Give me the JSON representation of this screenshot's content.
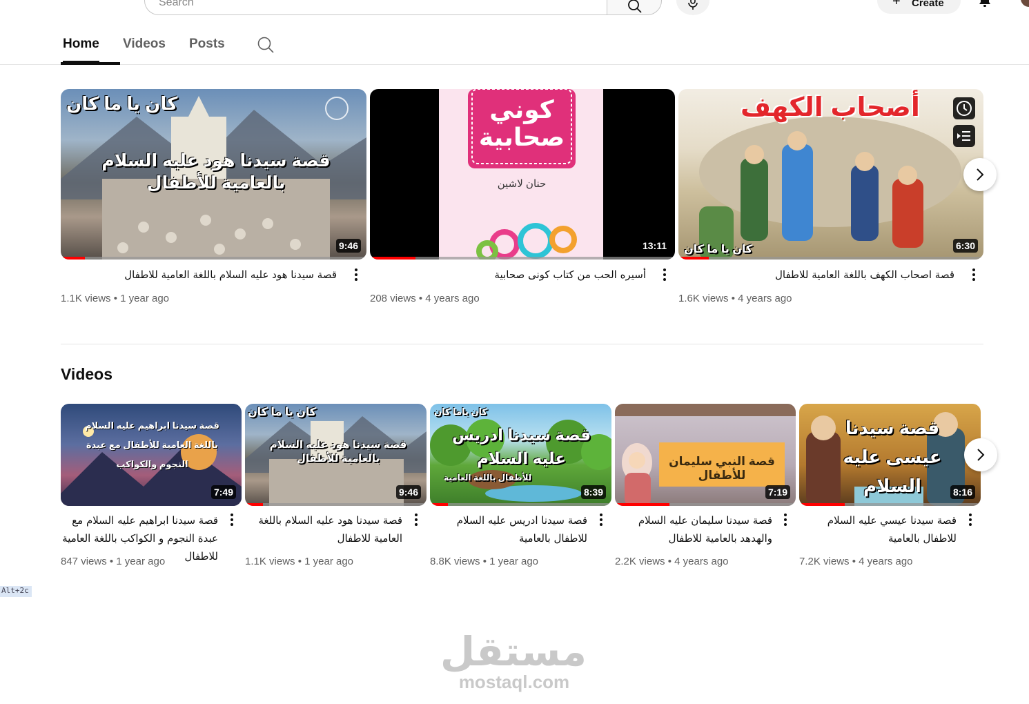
{
  "header": {
    "search_placeholder": "Search",
    "create_label": "Create"
  },
  "tabs": [
    {
      "label": "Home"
    },
    {
      "label": "Videos"
    },
    {
      "label": "Posts"
    }
  ],
  "featured": [
    {
      "title": "قصة سيدنا هود عليه السلام باللغة العامية للاطفال",
      "views": "1.1K views",
      "age": "1 year ago",
      "duration": "9:46",
      "progress": 0.08,
      "thumb_top_text": "كان يا ما كان",
      "thumb_main_text": "قصة سيدنا هود عليه السلام بالعامية للأطفال"
    },
    {
      "title": "أسيره الحب من كتاب كونى صحابية",
      "views": "208 views",
      "age": "4 years ago",
      "duration": "13:11",
      "progress": 0.15,
      "thumb_main_text": "كوني صحابية",
      "thumb_sub_text": "حنان لاشين"
    },
    {
      "title": "قصة اصحاب الكهف باللغة العامية للاطفال",
      "views": "1.6K views",
      "age": "4 years ago",
      "duration": "6:30",
      "progress": 0.1,
      "thumb_top_text": "أصحاب الكهف",
      "thumb_bottom_text": "كان يا ما كان"
    }
  ],
  "videos_section": {
    "title": "Videos",
    "items": [
      {
        "title": "قصة سيدنا ابراهيم عليه السلام مع عبدة النجوم و الكواكب باللغة العامية للاطفال",
        "views": "847 views",
        "age": "1 year ago",
        "duration": "7:49",
        "progress": 0.0,
        "thumb_main_text": "قصة سيدنا ابراهيم عليه السلام باللغة العامية للأطفال مع عبدة النجوم والكواكب"
      },
      {
        "title": "قصة سيدنا هود عليه السلام باللغة العامية للاطفال",
        "views": "1.1K views",
        "age": "1 year ago",
        "duration": "9:46",
        "progress": 0.1,
        "thumb_top_text": "كان يا ما كان",
        "thumb_main_text": "قصة سيدنا هود عليه السلام بالعامية للأطفال"
      },
      {
        "title": "قصة سيدنا ادريس عليه السلام للاطفال بالعامية",
        "views": "8.8K views",
        "age": "1 year ago",
        "duration": "8:39",
        "progress": 0.1,
        "thumb_top_text": "كان ياما كان",
        "thumb_main_text": "قصة سيدنا ادريس عليه السلام",
        "thumb_sub_text": "للأطفال باللغة العامية"
      },
      {
        "title": "قصة سيدنا سليمان عليه السلام والهدهد بالعامية للاطفال",
        "views": "2.2K views",
        "age": "4 years ago",
        "duration": "7:19",
        "progress": 0.3,
        "thumb_main_text": "قصة النبي سليمان للأطفال"
      },
      {
        "title": "قصة سيدنا عيسي عليه السلام للاطفال بالعامية",
        "views": "7.2K views",
        "age": "4 years ago",
        "duration": "8:16",
        "progress": 0.25,
        "thumb_main_text": "قصة سيدنا عيسى عليه السلام"
      }
    ]
  },
  "corner_tag": "Alt+2c",
  "watermark": {
    "arabic": "مستقل",
    "latin": "mostaql.com"
  },
  "colors": {
    "progress": "#ff0000",
    "text_primary": "#0f0f0f",
    "text_secondary": "#606060"
  }
}
